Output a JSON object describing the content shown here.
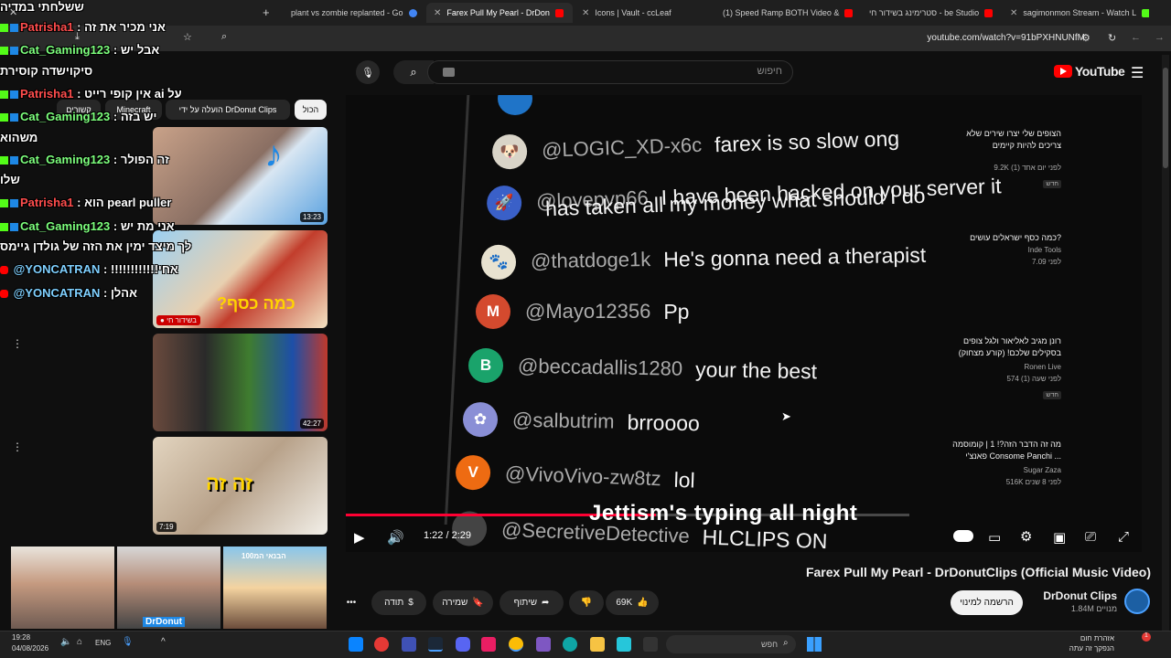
{
  "browser": {
    "tabs": [
      {
        "label": "plant vs zombie replanted - Go",
        "color": "#4285f4"
      },
      {
        "label": "Farex Pull My Pearl - DrDon",
        "color": "#ff0000"
      },
      {
        "label": "Icons | Vault - ccLeaf",
        "color": "#888888"
      },
      {
        "label": "(1) Speed Ramp BOTH Video &",
        "color": "#ff0000"
      },
      {
        "label": "סטרימינג בשידור חי - be Studio",
        "color": "#ff0000"
      },
      {
        "label": "sagimonmon Stream - Watch L",
        "color": "#53fc18"
      }
    ],
    "url": "youtube.com/watch?v=91bPXHNUNfM"
  },
  "youtube": {
    "logo_text": "YouTube",
    "search_placeholder": "חיפוש",
    "chips": [
      "הכול",
      "הועלה על ידי DrDonut Clips",
      "Minecraft",
      "קשורים"
    ]
  },
  "player": {
    "comments": [
      {
        "avatar": "🐶",
        "bg": "#d9d4c8",
        "handle": "@LOGIC_XD-x6c",
        "text": "farex is so slow ong"
      },
      {
        "avatar": "🚀",
        "bg": "#3a60c8",
        "handle": "@lovepvp66",
        "text": "I have been hacked on your server it",
        "text2": "has taken all my money what should I do"
      },
      {
        "avatar": "🐾",
        "bg": "#e8e2d0",
        "handle": "@thatdoge1k",
        "text": "He's gonna need a therapist"
      },
      {
        "avatar": "M",
        "bg": "#d44a2e",
        "handle": "@Mayo12356",
        "text": "Pp"
      },
      {
        "avatar": "B",
        "bg": "#1aa36b",
        "handle": "@beccadallis1280",
        "text": "your the best"
      },
      {
        "avatar": "✿",
        "bg": "#8a8fd6",
        "handle": "@salbutrim",
        "text": "brroooo"
      },
      {
        "avatar": "V",
        "bg": "#ee6b12",
        "handle": "@VivoVivo-zw8tz",
        "text": "lol"
      },
      {
        "avatar": "",
        "bg": "#444444",
        "handle": "@SecretiveDetective",
        "text": "HLCLIPS ON"
      }
    ],
    "lyric": "Jettism's typing all night",
    "time_current": "1:22",
    "time_total": "2:29",
    "progress": 0.55
  },
  "video": {
    "title": "Farex Pull My Pearl - DrDonutClips (Official Music Video)",
    "channel": "DrDonut Clips",
    "subs": "1.84M מנויים",
    "subscribe": "הרשמה למינוי",
    "likes": "69K",
    "share": "שיתוף",
    "save": "שמירה",
    "thanks": "תודה"
  },
  "sidebar": {
    "videos": [
      {
        "title1": "הצופים שלי יצרו שירים שלא",
        "title2": "צריכים להיות קיימים",
        "channel": "",
        "stats": "9.2K  לפני יום אחד (1)",
        "badge": "חדש",
        "duration": "13:23"
      },
      {
        "title1": "כמה כסף ישראלים עושים?",
        "title2": "",
        "channel": "Inde Tools",
        "stats": "לפני 7.09",
        "badge": "",
        "duration": "● בשידור חי"
      },
      {
        "title1": "רונן מגיב לאליאור ולגל צופים",
        "title2": "בסקילים שלכם! (קורע מצחוק)",
        "channel": "Ronen Live",
        "stats": "574  לפני שעה (1)",
        "badge": "חדש",
        "duration": "42:27"
      },
      {
        "title1": "מה זה הדבר הזה?! 1 | קומוסמה",
        "title2": "פאנצ'י Consome Panchi ...",
        "channel": "Sugar Zaza",
        "stats": "516K  לפני 8 שנים",
        "badge": "",
        "duration": "7:19"
      }
    ]
  },
  "chat_overlay": [
    {
      "name": "Patrisha1",
      "color": "red",
      "msg": " : אני מכיר את זה"
    },
    {
      "name": "Cat_Gaming123",
      "color": "green",
      "msg": " : אבל יש"
    },
    {
      "name": "",
      "color": "green",
      "msg": "סיקוישדה קוסירת"
    },
    {
      "name": "Patrisha1",
      "color": "red",
      "msg": " : אין קופי רייט ai על"
    },
    {
      "name": "Cat_Gaming123",
      "color": "green",
      "msg": " : יש בזה"
    },
    {
      "name": "",
      "color": "green",
      "msg": "משהוא"
    },
    {
      "name": "Cat_Gaming123",
      "color": "green",
      "msg": " : זה הפולר"
    },
    {
      "name": "",
      "color": "green",
      "msg": "שלו"
    },
    {
      "name": "Patrisha1",
      "color": "red",
      "msg": " : הוא pearl puller"
    },
    {
      "name": "Cat_Gaming123",
      "color": "green",
      "msg": " : אני מת יש"
    },
    {
      "name": "",
      "color": "green",
      "msg": "לך מיצד ימין את הזה של גולדן גיימס"
    },
    {
      "name": "@YONCATRAN",
      "color": "blue",
      "msg": " : !!!!!!!!!!!!אחי"
    },
    {
      "name": "@YONCATRAN",
      "color": "blue",
      "msg": " : אהלן"
    }
  ],
  "chat_header": "ששלחתי במדיה",
  "taskbar": {
    "time": "19:28",
    "date": "04/08/2026",
    "lang": "ENG",
    "search": "חפש",
    "weather1": "אזהרת חום",
    "weather2": "הנפקך זה עתה"
  },
  "cam_overlay_label": "DrDonut",
  "video_banner": "הבנאי המ100"
}
